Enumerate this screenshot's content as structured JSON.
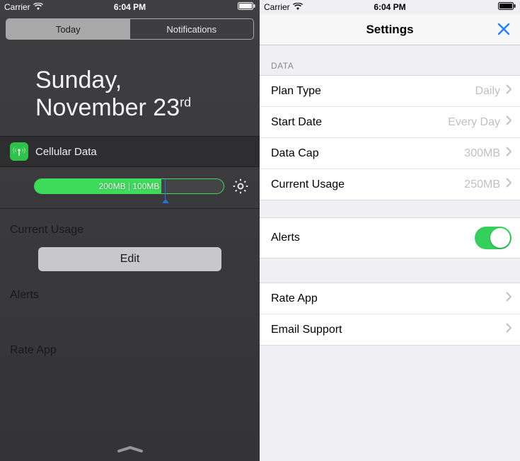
{
  "left": {
    "status": {
      "carrier": "Carrier",
      "time": "6:04 PM"
    },
    "segments": {
      "today": "Today",
      "notifications": "Notifications"
    },
    "date": {
      "line1": "Sunday,",
      "line2_prefix": "November 23",
      "line2_ordinal": "rd"
    },
    "widget": {
      "title": "Cellular Data",
      "progress_label": "200MB | 100MB",
      "fill_percent": 67,
      "marker_percent": 69
    },
    "edit_label": "Edit",
    "dimmed": {
      "row1": "Current Usage",
      "row2": "Alerts",
      "row3": "Rate App"
    }
  },
  "right": {
    "status": {
      "carrier": "Carrier",
      "time": "6:04 PM"
    },
    "nav_title": "Settings",
    "section_data": "DATA",
    "rows": {
      "plan_type": {
        "label": "Plan Type",
        "value": "Daily"
      },
      "start_date": {
        "label": "Start Date",
        "value": "Every Day"
      },
      "data_cap": {
        "label": "Data Cap",
        "value": "300MB"
      },
      "current_usage": {
        "label": "Current Usage",
        "value": "250MB"
      },
      "alerts": {
        "label": "Alerts",
        "on": true
      },
      "rate_app": {
        "label": "Rate App"
      },
      "email_support": {
        "label": "Email Support"
      }
    }
  }
}
